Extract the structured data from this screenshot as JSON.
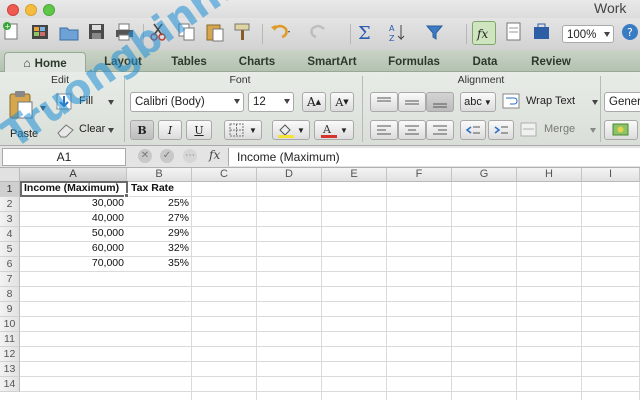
{
  "window": {
    "title": "Work"
  },
  "toolbar": {
    "zoom": "100%"
  },
  "tabs": [
    {
      "label": "Home"
    },
    {
      "label": "Layout"
    },
    {
      "label": "Tables"
    },
    {
      "label": "Charts"
    },
    {
      "label": "SmartArt"
    },
    {
      "label": "Formulas"
    },
    {
      "label": "Data"
    },
    {
      "label": "Review"
    }
  ],
  "ribbon": {
    "groups": {
      "edit": "Edit",
      "font": "Font",
      "alignment": "Alignment"
    },
    "paste_label": "Paste",
    "fill_label": "Fill",
    "clear_label": "Clear",
    "font_name": "Calibri (Body)",
    "font_size": "12",
    "bold": "B",
    "italic": "I",
    "underline": "U",
    "wrap_text": "Wrap Text",
    "merge": "Merge",
    "abc": "abc",
    "number_format": "General"
  },
  "formula_bar": {
    "name_box": "A1",
    "fx": "fx",
    "content": "Income (Maximum)"
  },
  "sheet": {
    "columns": [
      "A",
      "B",
      "C",
      "D",
      "E",
      "F",
      "G",
      "H",
      "I"
    ],
    "rows": [
      "1",
      "2",
      "3",
      "4",
      "5",
      "6",
      "7",
      "8",
      "9",
      "10",
      "11",
      "12",
      "13",
      "14"
    ],
    "header": {
      "a": "Income (Maximum)",
      "b": "Tax Rate"
    },
    "data": [
      {
        "income": "30,000",
        "rate": "25%"
      },
      {
        "income": "40,000",
        "rate": "27%"
      },
      {
        "income": "50,000",
        "rate": "29%"
      },
      {
        "income": "60,000",
        "rate": "32%"
      },
      {
        "income": "70,000",
        "rate": "35%"
      }
    ]
  },
  "watermark": {
    "text": "Truongbinh.vn",
    "color": "#1f8fd6"
  }
}
